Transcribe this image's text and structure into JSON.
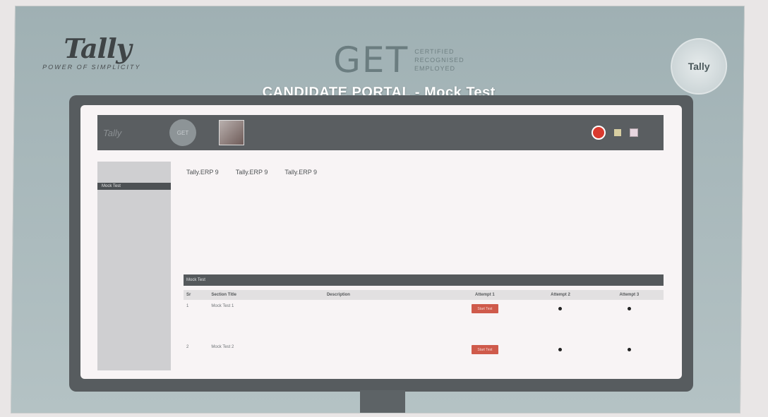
{
  "poster": {
    "brand": "Tally",
    "brand_tagline": "POWER OF SIMPLICITY",
    "get_mark": "GET",
    "get_words": [
      "CERTIFIED",
      "RECOGNISED",
      "EMPLOYED"
    ],
    "seal_text": "Tally",
    "portal_title": "CANDIDATE PORTAL - Mock Test"
  },
  "header": {
    "logo_text": "Tally",
    "circle_text": "GET",
    "user_name": "",
    "user_id": "",
    "last_login": "",
    "message": ""
  },
  "sidebar": {
    "items": [
      {
        "label": "",
        "active": false
      },
      {
        "label": "",
        "active": false
      },
      {
        "label": "",
        "active": false
      },
      {
        "label": "Mock Test",
        "active": true
      },
      {
        "label": "",
        "active": false
      },
      {
        "label": "",
        "active": false
      },
      {
        "label": "",
        "active": false
      },
      {
        "label": "",
        "active": false
      },
      {
        "label": "",
        "active": false
      },
      {
        "label": "",
        "active": false
      },
      {
        "label": "",
        "active": false
      },
      {
        "label": "",
        "active": false
      },
      {
        "label": "",
        "active": false
      }
    ]
  },
  "tabs": [
    "Tally.ERP 9",
    "Tally.ERP 9",
    "Tally.ERP 9"
  ],
  "instructions": [
    "",
    "",
    "",
    "",
    "",
    "",
    "",
    "",
    ""
  ],
  "mock_test": {
    "section_title": "Mock Test",
    "columns": [
      "Sr",
      "Section Title",
      "Description",
      "Attempt 1",
      "Attempt 2",
      "Attempt 3"
    ],
    "rows": [
      {
        "sr": "1",
        "title": "Mock Test 1",
        "description": [
          "",
          "",
          "",
          ""
        ],
        "attempt1": "Start Test",
        "attempt2": "•",
        "attempt3": "•"
      },
      {
        "sr": "2",
        "title": "Mock Test 2",
        "description": [
          "",
          "",
          ""
        ],
        "attempt1": "Start Test",
        "attempt2": "•",
        "attempt3": "•"
      }
    ]
  },
  "colors": {
    "accent": "#cf5a4b",
    "header_bg": "#5a5e61",
    "poster_bg": "#a7b7ba"
  }
}
